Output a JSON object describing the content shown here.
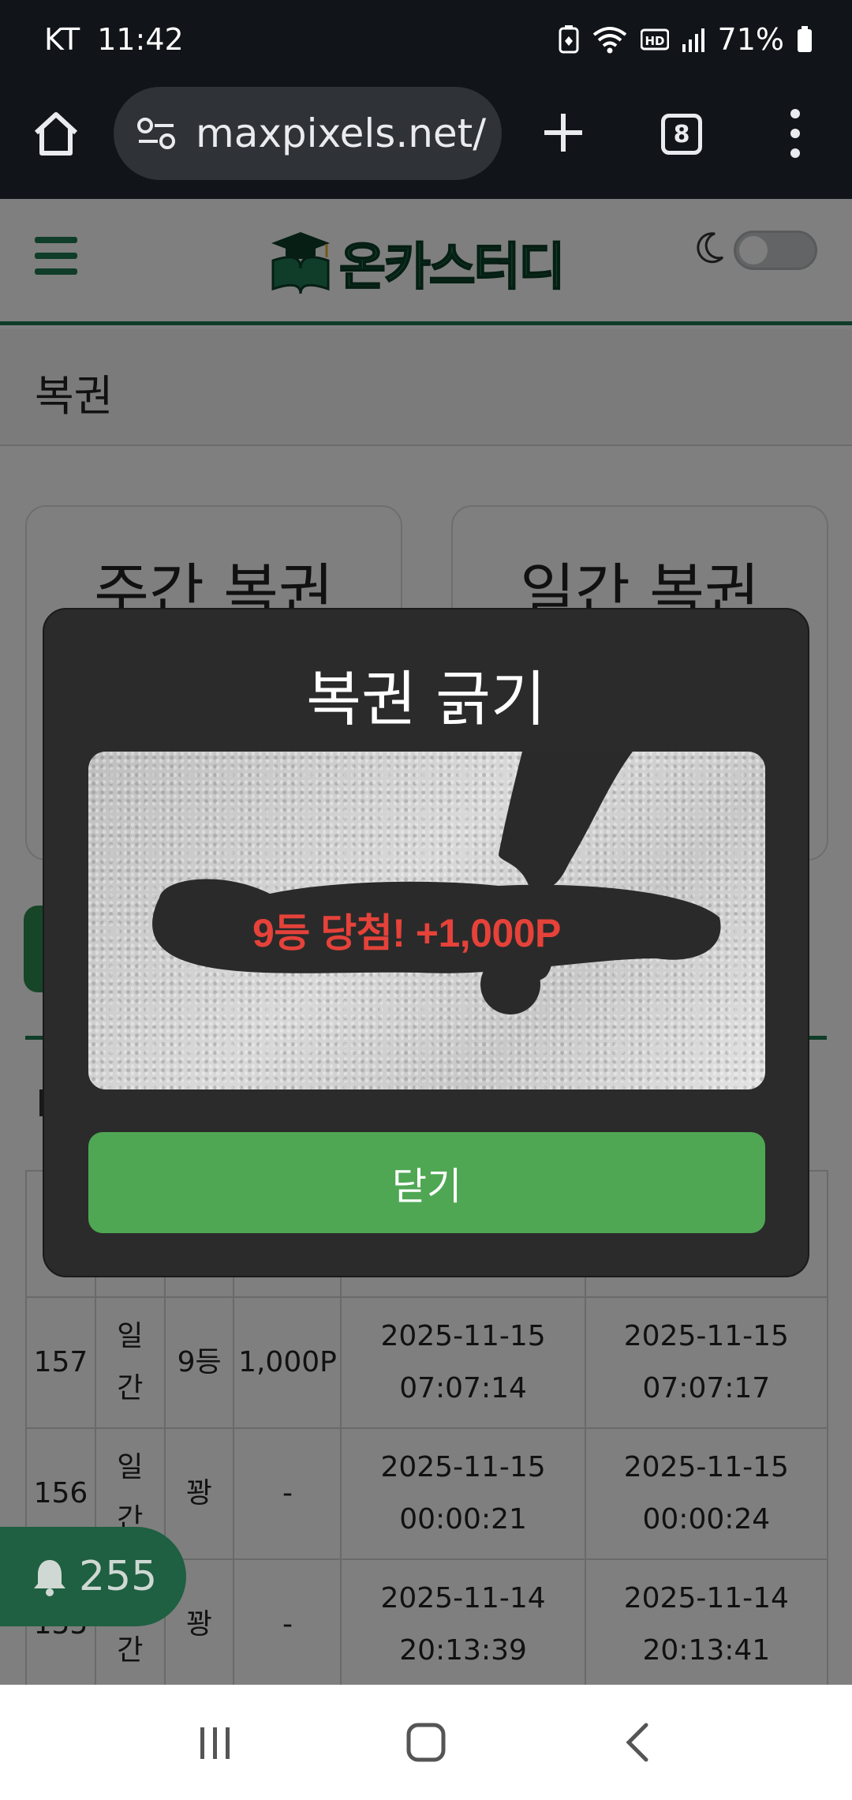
{
  "status_bar": {
    "carrier": "KT",
    "time": "11:42",
    "battery_percent": "71%",
    "icons": [
      "battery-saver-icon",
      "wifi-icon",
      "hd-voice-icon",
      "signal-icon",
      "battery-icon"
    ]
  },
  "browser": {
    "url": "maxpixels.net/",
    "tab_count": "8"
  },
  "site": {
    "logo_text": "온카스터디",
    "dark_mode_on": false
  },
  "page": {
    "title": "복권",
    "cards": [
      {
        "title": "주간 복권"
      },
      {
        "title": "일간 복권"
      }
    ],
    "history_rows": [
      {
        "id": "157",
        "type": "일간",
        "rank": "9등",
        "prize": "1,000P",
        "purchased_date": "2025-11-15",
        "purchased_time": "07:07:14",
        "scratched_date": "2025-11-15",
        "scratched_time": "07:07:17"
      },
      {
        "id": "156",
        "type": "일간",
        "rank": "꽝",
        "prize": "-",
        "purchased_date": "2025-11-15",
        "purchased_time": "00:00:21",
        "scratched_date": "2025-11-15",
        "scratched_time": "00:00:24"
      },
      {
        "id": "155",
        "type": "일간",
        "rank": "꽝",
        "prize": "-",
        "purchased_date": "2025-11-14",
        "purchased_time": "20:13:39",
        "scratched_date": "2025-11-14",
        "scratched_time": "20:13:41"
      }
    ]
  },
  "notification": {
    "count": "255"
  },
  "modal": {
    "title": "복권 긁기",
    "result_text": "9등 당첨! +1,000P",
    "close_label": "닫기"
  },
  "colors": {
    "brand_green": "#1e7a52",
    "button_green": "#4fa754",
    "prize_red": "#e5423a",
    "modal_bg": "#2b2b2b"
  }
}
